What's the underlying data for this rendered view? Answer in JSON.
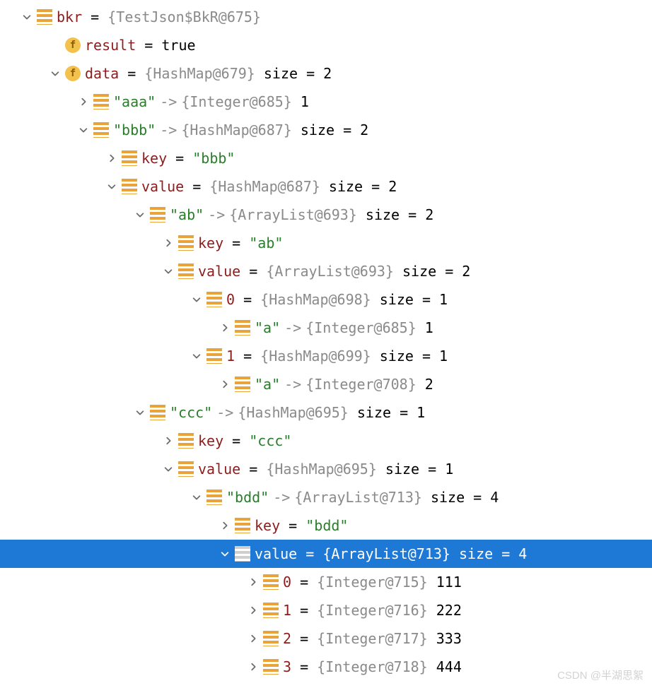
{
  "watermark": "CSDN @半湖思絮",
  "rows": [
    {
      "indent": 0,
      "arrow": "down",
      "icon": "obj",
      "sel": false,
      "seg": [
        [
          "name",
          "bkr"
        ],
        [
          "eq",
          " = "
        ],
        [
          "type",
          "{TestJson$BkR@675}"
        ]
      ]
    },
    {
      "indent": 1,
      "arrow": "none",
      "icon": "fld",
      "sel": false,
      "seg": [
        [
          "name",
          "result"
        ],
        [
          "eq",
          " = "
        ],
        [
          "plain",
          "true"
        ]
      ]
    },
    {
      "indent": 1,
      "arrow": "down",
      "icon": "fld",
      "sel": false,
      "seg": [
        [
          "name",
          "data"
        ],
        [
          "eq",
          " = "
        ],
        [
          "type",
          "{HashMap@679} "
        ],
        [
          "plain",
          " size = 2"
        ]
      ]
    },
    {
      "indent": 2,
      "arrow": "right",
      "icon": "obj",
      "sel": false,
      "seg": [
        [
          "str",
          "\"aaa\""
        ],
        [
          "arrowop",
          "->"
        ],
        [
          "type",
          "{Integer@685}"
        ],
        [
          "plain",
          " 1"
        ]
      ]
    },
    {
      "indent": 2,
      "arrow": "down",
      "icon": "obj",
      "sel": false,
      "seg": [
        [
          "str",
          "\"bbb\""
        ],
        [
          "arrowop",
          "->"
        ],
        [
          "type",
          "{HashMap@687} "
        ],
        [
          "plain",
          " size = 2"
        ]
      ]
    },
    {
      "indent": 3,
      "arrow": "right",
      "icon": "obj",
      "sel": false,
      "seg": [
        [
          "name",
          "key"
        ],
        [
          "eq",
          " = "
        ],
        [
          "str",
          "\"bbb\""
        ]
      ]
    },
    {
      "indent": 3,
      "arrow": "down",
      "icon": "obj",
      "sel": false,
      "seg": [
        [
          "name",
          "value"
        ],
        [
          "eq",
          " = "
        ],
        [
          "type",
          "{HashMap@687} "
        ],
        [
          "plain",
          " size = 2"
        ]
      ]
    },
    {
      "indent": 4,
      "arrow": "down",
      "icon": "obj",
      "sel": false,
      "seg": [
        [
          "str",
          "\"ab\""
        ],
        [
          "arrowop",
          "->"
        ],
        [
          "type",
          "{ArrayList@693} "
        ],
        [
          "plain",
          " size = 2"
        ]
      ]
    },
    {
      "indent": 5,
      "arrow": "right",
      "icon": "obj",
      "sel": false,
      "seg": [
        [
          "name",
          "key"
        ],
        [
          "eq",
          " = "
        ],
        [
          "str",
          "\"ab\""
        ]
      ]
    },
    {
      "indent": 5,
      "arrow": "down",
      "icon": "obj",
      "sel": false,
      "seg": [
        [
          "name",
          "value"
        ],
        [
          "eq",
          " = "
        ],
        [
          "type",
          "{ArrayList@693} "
        ],
        [
          "plain",
          " size = 2"
        ]
      ]
    },
    {
      "indent": 6,
      "arrow": "down",
      "icon": "obj",
      "sel": false,
      "seg": [
        [
          "name",
          "0"
        ],
        [
          "eq",
          " = "
        ],
        [
          "type",
          "{HashMap@698} "
        ],
        [
          "plain",
          " size = 1"
        ]
      ]
    },
    {
      "indent": 7,
      "arrow": "right",
      "icon": "obj",
      "sel": false,
      "seg": [
        [
          "str",
          "\"a\""
        ],
        [
          "arrowop",
          "->"
        ],
        [
          "type",
          "{Integer@685}"
        ],
        [
          "plain",
          " 1"
        ]
      ]
    },
    {
      "indent": 6,
      "arrow": "down",
      "icon": "obj",
      "sel": false,
      "seg": [
        [
          "name",
          "1"
        ],
        [
          "eq",
          " = "
        ],
        [
          "type",
          "{HashMap@699} "
        ],
        [
          "plain",
          " size = 1"
        ]
      ]
    },
    {
      "indent": 7,
      "arrow": "right",
      "icon": "obj",
      "sel": false,
      "seg": [
        [
          "str",
          "\"a\""
        ],
        [
          "arrowop",
          "->"
        ],
        [
          "type",
          "{Integer@708}"
        ],
        [
          "plain",
          " 2"
        ]
      ]
    },
    {
      "indent": 4,
      "arrow": "down",
      "icon": "obj",
      "sel": false,
      "seg": [
        [
          "str",
          "\"ccc\""
        ],
        [
          "arrowop",
          "->"
        ],
        [
          "type",
          "{HashMap@695} "
        ],
        [
          "plain",
          " size = 1"
        ]
      ]
    },
    {
      "indent": 5,
      "arrow": "right",
      "icon": "obj",
      "sel": false,
      "seg": [
        [
          "name",
          "key"
        ],
        [
          "eq",
          " = "
        ],
        [
          "str",
          "\"ccc\""
        ]
      ]
    },
    {
      "indent": 5,
      "arrow": "down",
      "icon": "obj",
      "sel": false,
      "seg": [
        [
          "name",
          "value"
        ],
        [
          "eq",
          " = "
        ],
        [
          "type",
          "{HashMap@695} "
        ],
        [
          "plain",
          " size = 1"
        ]
      ]
    },
    {
      "indent": 6,
      "arrow": "down",
      "icon": "obj",
      "sel": false,
      "seg": [
        [
          "str",
          "\"bdd\""
        ],
        [
          "arrowop",
          "->"
        ],
        [
          "type",
          "{ArrayList@713} "
        ],
        [
          "plain",
          " size = 4"
        ]
      ]
    },
    {
      "indent": 7,
      "arrow": "right",
      "icon": "obj",
      "sel": false,
      "seg": [
        [
          "name",
          "key"
        ],
        [
          "eq",
          " = "
        ],
        [
          "str",
          "\"bdd\""
        ]
      ]
    },
    {
      "indent": 7,
      "arrow": "down",
      "icon": "obj",
      "sel": true,
      "seg": [
        [
          "name",
          "value"
        ],
        [
          "eq",
          " = "
        ],
        [
          "type",
          "{ArrayList@713} "
        ],
        [
          "plain",
          " size = 4"
        ]
      ]
    },
    {
      "indent": 8,
      "arrow": "right",
      "icon": "obj",
      "sel": false,
      "seg": [
        [
          "name",
          "0"
        ],
        [
          "eq",
          " = "
        ],
        [
          "type",
          "{Integer@715}"
        ],
        [
          "plain",
          " 111"
        ]
      ]
    },
    {
      "indent": 8,
      "arrow": "right",
      "icon": "obj",
      "sel": false,
      "seg": [
        [
          "name",
          "1"
        ],
        [
          "eq",
          " = "
        ],
        [
          "type",
          "{Integer@716}"
        ],
        [
          "plain",
          " 222"
        ]
      ]
    },
    {
      "indent": 8,
      "arrow": "right",
      "icon": "obj",
      "sel": false,
      "seg": [
        [
          "name",
          "2"
        ],
        [
          "eq",
          " = "
        ],
        [
          "type",
          "{Integer@717}"
        ],
        [
          "plain",
          " 333"
        ]
      ]
    },
    {
      "indent": 8,
      "arrow": "right",
      "icon": "obj",
      "sel": false,
      "seg": [
        [
          "name",
          "3"
        ],
        [
          "eq",
          " = "
        ],
        [
          "type",
          "{Integer@718}"
        ],
        [
          "plain",
          " 444"
        ]
      ]
    }
  ]
}
